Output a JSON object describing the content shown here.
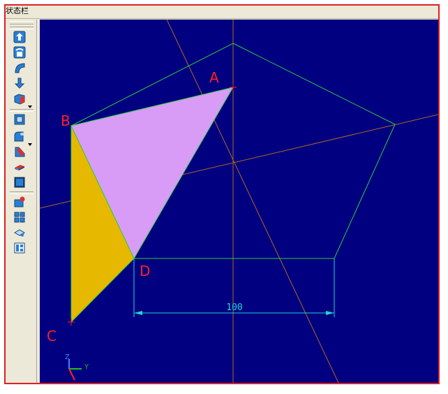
{
  "window": {
    "title": "状态栏"
  },
  "toolbar": {
    "icons": [
      "extrude-icon",
      "revolve-icon",
      "sweep-icon",
      "push-pull-icon",
      "box-icon",
      "shell-icon",
      "fillet-icon",
      "chamfer-icon",
      "face-offset-icon",
      "solid-icon",
      "boolean-icon",
      "pattern-icon",
      "transform-icon",
      "measure-icon"
    ]
  },
  "viewport": {
    "labels": {
      "a": "A",
      "b": "B",
      "c": "C",
      "d": "D"
    },
    "dimension": "100",
    "axes": {
      "z": "Z",
      "y": "Y"
    },
    "colors": {
      "background": "#000080",
      "pentagon": "#2ecc40",
      "face_top": "#d89cf6",
      "face_side": "#e6b800",
      "construction_lines": "#b06820",
      "labels": "#ff2020",
      "dimension": "#1ed6d6"
    }
  }
}
